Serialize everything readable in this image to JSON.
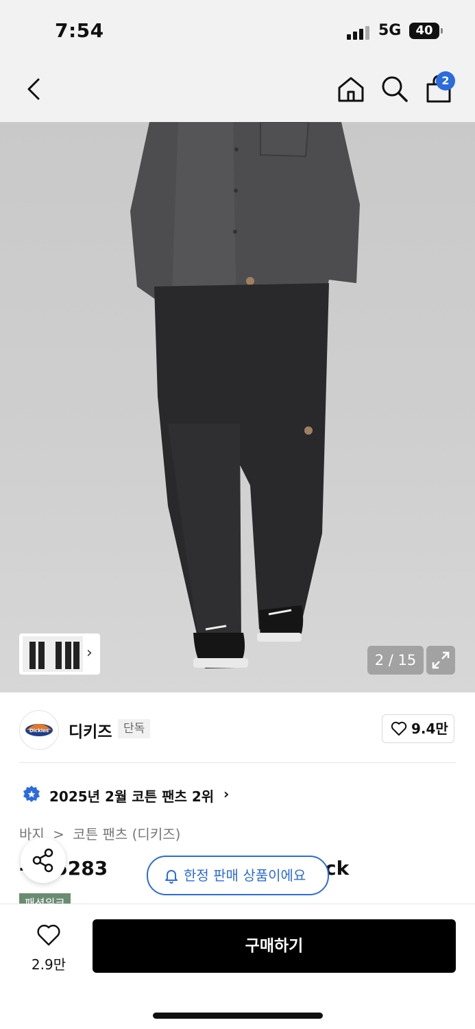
{
  "status_bar": {
    "time": "7:54",
    "network": "5G",
    "battery": "40"
  },
  "header": {
    "cart_count": "2"
  },
  "gallery": {
    "counter": "2 / 15"
  },
  "brand": {
    "name": "디키즈",
    "tag": "단독",
    "likes": "9.4만",
    "logo_text": "Dickies"
  },
  "ranking": {
    "text": "2025년 2월 코튼 팬츠 2위"
  },
  "breadcrumb": {
    "items": [
      "바지",
      ">",
      "코튼 팬츠 (디키즈)"
    ]
  },
  "product": {
    "title_visible_left": "-I 85283",
    "title_visible_right": "ck",
    "badge_partial": "패션위크"
  },
  "notice": {
    "limited_label": "한정 판매 상품이에요"
  },
  "bottom_bar": {
    "wish_count": "2.9만",
    "buy_label": "구매하기"
  },
  "colors": {
    "accent": "#2a6bde",
    "buy_bg": "#000000",
    "badge_green": "#6a8c72"
  }
}
